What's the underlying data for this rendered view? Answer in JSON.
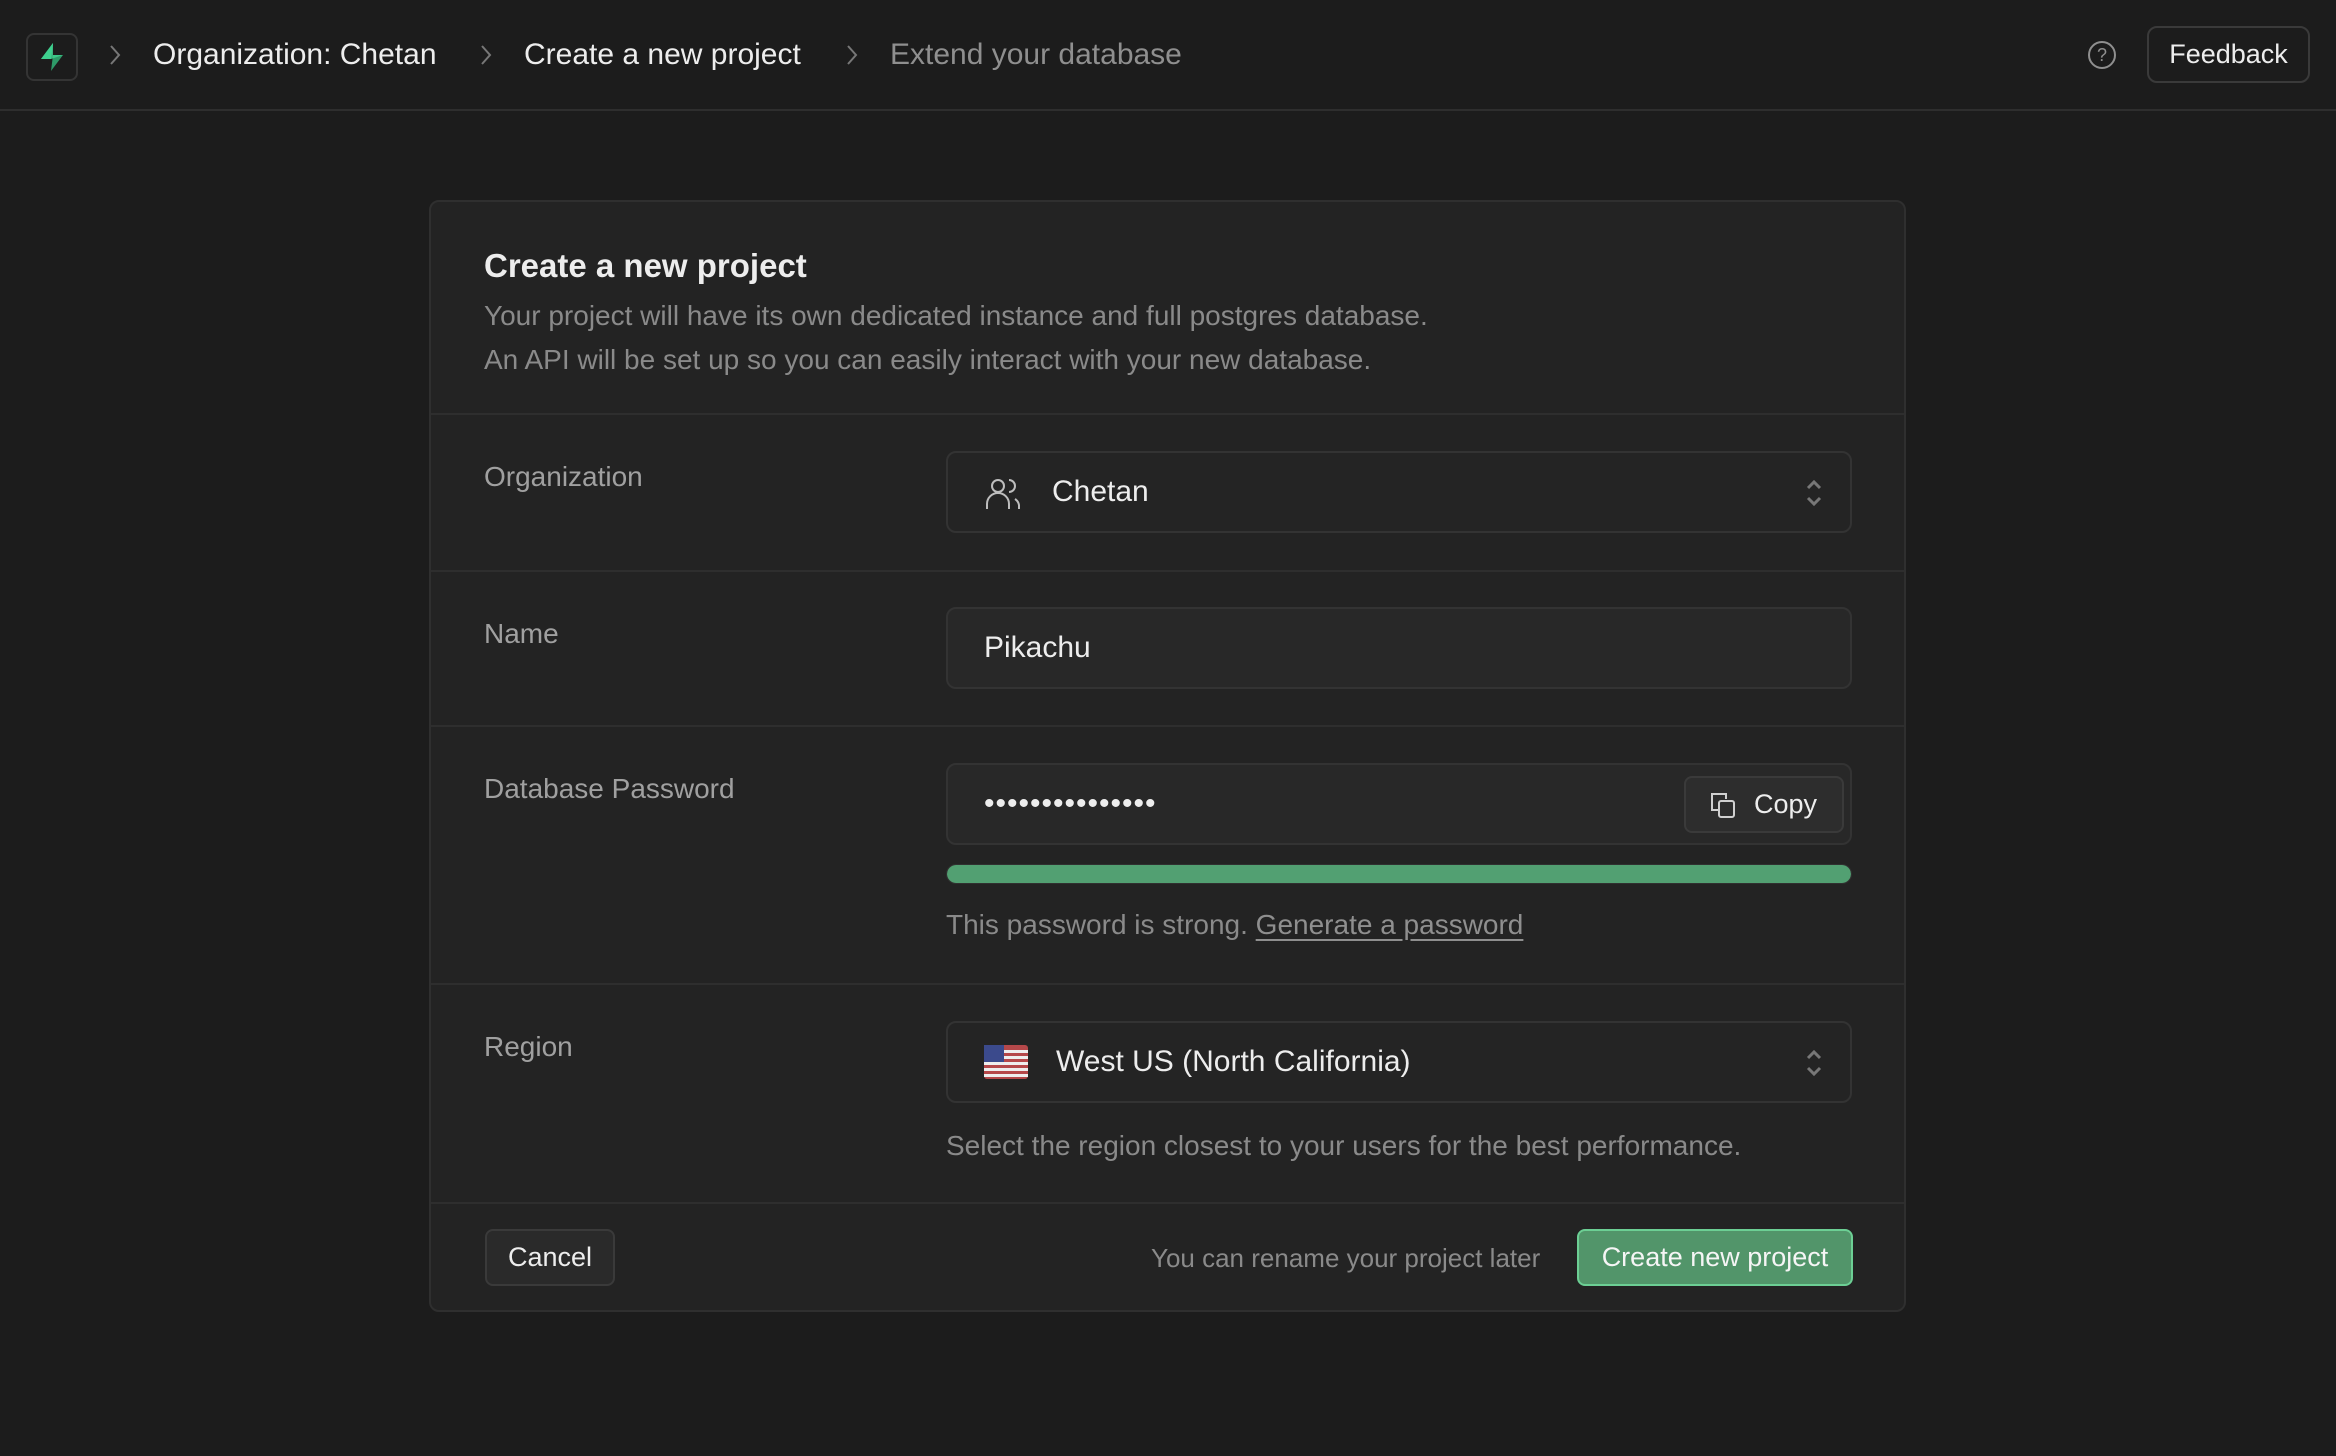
{
  "topbar": {
    "logo_icon": "supabase-bolt-icon",
    "breadcrumbs": [
      {
        "label": "Organization: Chetan"
      },
      {
        "label": "Create a new project"
      },
      {
        "label": "Extend your database"
      }
    ],
    "help_icon": "help-circle-icon",
    "help_glyph": "?",
    "feedback_label": "Feedback"
  },
  "card": {
    "title": "Create a new project",
    "description_lines": [
      "Your project will have its own dedicated instance and full postgres database.",
      "An API will be set up so you can easily interact with your new database."
    ],
    "organization": {
      "label": "Organization",
      "icon": "users-icon",
      "value": "Chetan"
    },
    "name": {
      "label": "Name",
      "value": "Pikachu"
    },
    "password": {
      "label": "Database Password",
      "masked_value": "•••••••••••••••",
      "copy_label": "Copy",
      "copy_icon": "copy-icon",
      "strength_fraction": 1.0,
      "strength_color": "#52a072",
      "hint_text": "This password is strong.",
      "generate_link": "Generate a password"
    },
    "region": {
      "label": "Region",
      "flag_icon": "us-flag-icon",
      "value": "West US (North California)",
      "hint": "Select the region closest to your users for the best performance."
    },
    "footer": {
      "cancel_label": "Cancel",
      "note": "You can rename your project later",
      "create_label": "Create new project",
      "create_color": "#52956a"
    }
  }
}
